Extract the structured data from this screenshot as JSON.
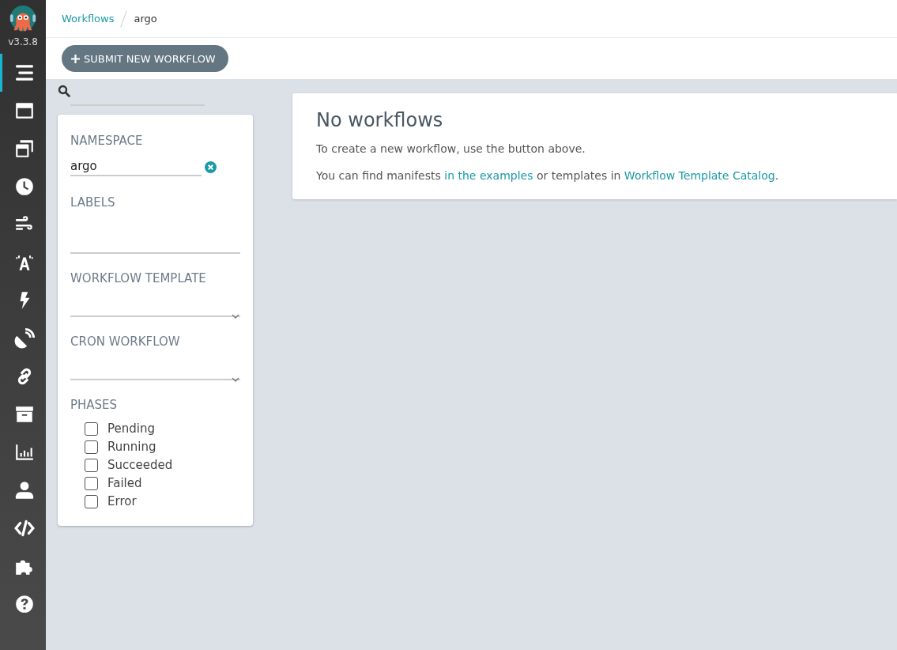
{
  "sidebar": {
    "version": "v3.3.8",
    "items": [
      {
        "kind": "list",
        "selected": true
      },
      {
        "kind": "window",
        "selected": false
      },
      {
        "kind": "windows",
        "selected": false
      },
      {
        "kind": "clock",
        "selected": false
      },
      {
        "kind": "wind",
        "selected": false
      },
      {
        "kind": "broadcast",
        "selected": false
      },
      {
        "kind": "bolt",
        "selected": false
      },
      {
        "kind": "satellite",
        "selected": false
      },
      {
        "kind": "link",
        "selected": false
      },
      {
        "kind": "archive",
        "selected": false
      },
      {
        "kind": "chart",
        "selected": false
      },
      {
        "kind": "user",
        "selected": false
      },
      {
        "kind": "code",
        "selected": false
      },
      {
        "kind": "puzzle",
        "selected": false
      },
      {
        "kind": "help",
        "selected": false
      }
    ]
  },
  "breadcrumbs": [
    {
      "label": "Workflows",
      "link": true
    },
    {
      "label": "argo",
      "link": false
    }
  ],
  "toolbar": {
    "submit_button": "SUBMIT NEW WORKFLOW"
  },
  "filters": {
    "namespace": {
      "label": "NAMESPACE",
      "value": "argo"
    },
    "labels": {
      "label": "LABELS"
    },
    "workflow_template": {
      "label": "WORKFLOW TEMPLATE"
    },
    "cron_workflow": {
      "label": "CRON WORKFLOW"
    },
    "phases": {
      "label": "PHASES",
      "items": [
        {
          "label": "Pending",
          "checked": false
        },
        {
          "label": "Running",
          "checked": false
        },
        {
          "label": "Succeeded",
          "checked": false
        },
        {
          "label": "Failed",
          "checked": false
        },
        {
          "label": "Error",
          "checked": false
        }
      ]
    }
  },
  "empty_state": {
    "title": "No workflows",
    "text": "To create a new workflow, use the button above.",
    "text2_before": "You can find manifests ",
    "link1": "in the examples",
    "text2_middle": " or templates in ",
    "link2": "Workflow Template Catalog",
    "text2_after": "."
  }
}
